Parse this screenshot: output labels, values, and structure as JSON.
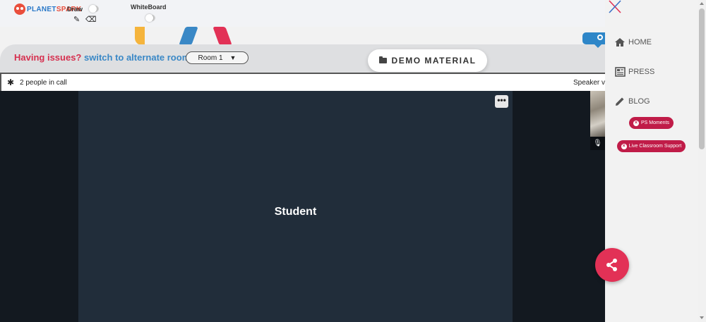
{
  "brand": {
    "logo_part1": "PLANET",
    "logo_part2": "SPARK"
  },
  "toolbar": {
    "draw_label": "Draw",
    "whiteboard_label": "WhiteBoard",
    "pencil_glyph": "✎",
    "eraser_glyph": "⌫"
  },
  "issues": {
    "question": "Having issues?",
    "switch": "switch to alternate room"
  },
  "room_select": {
    "selected": "Room 1",
    "caret": "▼"
  },
  "demo_material": {
    "label": "DEMO MATERIAL"
  },
  "call": {
    "people_text": "2 people in call",
    "speaker_view": "Speaker view",
    "gear_glyph": "✱"
  },
  "video": {
    "tile_name": "Student",
    "menu_glyph": "•••",
    "mic_glyph": "🎙"
  },
  "nav": {
    "items": [
      {
        "label": "HOME",
        "icon": "home-icon"
      },
      {
        "label": "PRESS",
        "icon": "newspaper-icon"
      },
      {
        "label": "BLOG",
        "icon": "pencil-icon"
      }
    ]
  },
  "pills": {
    "ps_moments": "PS Moments",
    "live_support": "Live Classroom Support",
    "close_glyph": "×"
  },
  "colors": {
    "accent_pink": "#e23156",
    "pill_red": "#c01c48",
    "link_blue": "#3a88c6",
    "issue_red": "#d6304f",
    "video_bg": "#212d3a"
  }
}
